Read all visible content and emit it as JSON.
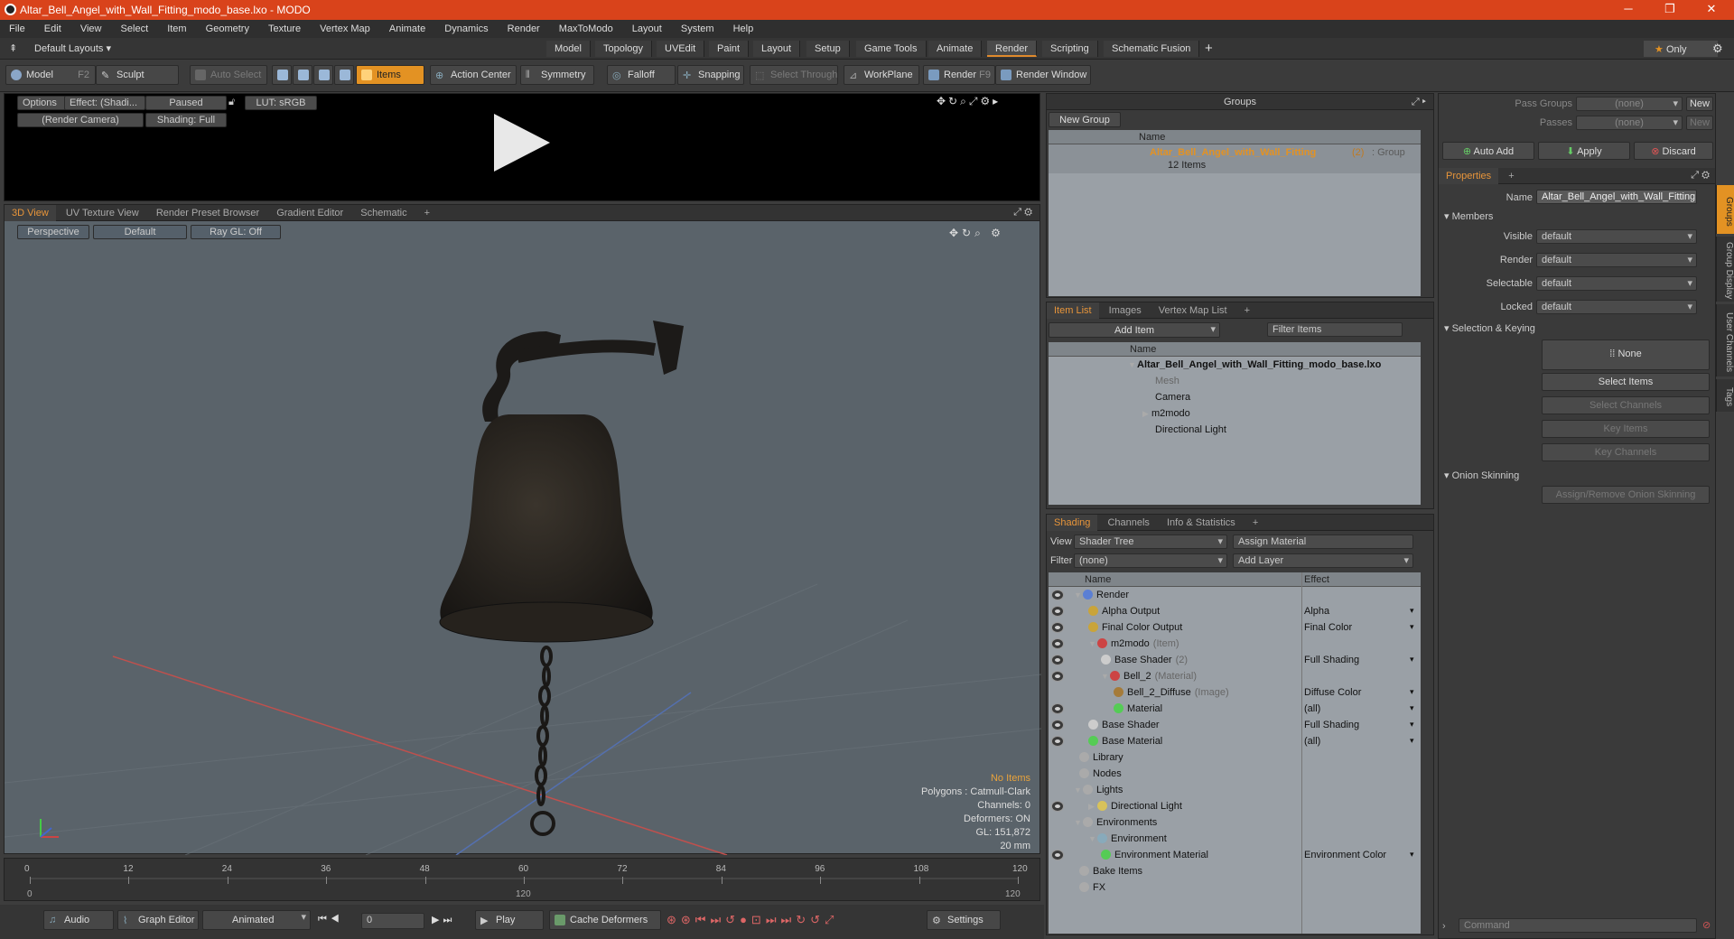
{
  "window": {
    "title": "Altar_Bell_Angel_with_Wall_Fitting_modo_base.lxo - MODO"
  },
  "menu": [
    "File",
    "Edit",
    "View",
    "Select",
    "Item",
    "Geometry",
    "Texture",
    "Vertex Map",
    "Animate",
    "Dynamics",
    "Render",
    "MaxToModo",
    "Layout",
    "System",
    "Help"
  ],
  "layouts": {
    "dropdown": "Default Layouts",
    "tabs": [
      "Model",
      "Topology",
      "UVEdit",
      "Paint",
      "Layout",
      "Setup",
      "Game Tools",
      "Animate",
      "Render",
      "Scripting",
      "Schematic Fusion"
    ],
    "active": "Render",
    "only_label": "Only"
  },
  "toolbar": {
    "model": "Model",
    "model_key": "F2",
    "sculpt": "Sculpt",
    "auto_select": "Auto Select",
    "items": "Items",
    "action_center": "Action Center",
    "symmetry": "Symmetry",
    "falloff": "Falloff",
    "snapping": "Snapping",
    "select_through": "Select Through",
    "workplane": "WorkPlane",
    "render": "Render",
    "render_key": "F9",
    "render_window": "Render Window"
  },
  "render_preview": {
    "options": "Options",
    "effect": "Effect: (Shadi...",
    "paused": "Paused",
    "lut": "LUT: sRGB",
    "camera": "(Render Camera)",
    "shading": "Shading: Full"
  },
  "viewport": {
    "tabs": [
      "3D View",
      "UV Texture View",
      "Render Preset Browser",
      "Gradient Editor",
      "Schematic"
    ],
    "perspective": "Perspective",
    "default": "Default",
    "raygl": "Ray GL: Off",
    "info": {
      "no_items": "No Items",
      "polygons": "Polygons : Catmull-Clark",
      "channels": "Channels: 0",
      "deformers": "Deformers: ON",
      "gl": "GL: 151,872",
      "unit": "20 mm"
    }
  },
  "timeline": {
    "ticks": [
      "0",
      "12",
      "24",
      "36",
      "48",
      "60",
      "72",
      "84",
      "96",
      "108",
      "120"
    ],
    "start": "0",
    "end": "120",
    "end_right": "120"
  },
  "bottombar": {
    "audio": "Audio",
    "graph_editor": "Graph Editor",
    "animated": "Animated",
    "frame": "0",
    "play": "Play",
    "cache_deformers": "Cache Deformers",
    "settings": "Settings"
  },
  "groups": {
    "title": "Groups",
    "new_group": "New Group",
    "col_name": "Name",
    "item_name": "Altar_Bell_Angel_with_Wall_Fitting",
    "item_count": "(2)",
    "item_type": ": Group",
    "item_sub": "12 Items"
  },
  "itemlist": {
    "tabs": [
      "Item List",
      "Images",
      "Vertex Map List"
    ],
    "add_item": "Add Item",
    "filter": "Filter Items",
    "col_name": "Name",
    "rows": [
      "Altar_Bell_Angel_with_Wall_Fitting_modo_base.lxo",
      "Mesh",
      "Camera",
      "m2modo",
      "Directional Light"
    ]
  },
  "shading": {
    "tabs": [
      "Shading",
      "Channels",
      "Info & Statistics"
    ],
    "view_label": "View",
    "view_value": "Shader Tree",
    "assign_material": "Assign Material",
    "filter_label": "Filter",
    "filter_value": "(none)",
    "add_layer": "Add Layer",
    "col_name": "Name",
    "col_effect": "Effect",
    "rows": [
      {
        "name": "Render",
        "effect": "",
        "sub": ""
      },
      {
        "name": "Alpha Output",
        "effect": "Alpha",
        "sub": ""
      },
      {
        "name": "Final Color Output",
        "effect": "Final Color",
        "sub": ""
      },
      {
        "name": "m2modo",
        "effect": "",
        "sub": "(Item)"
      },
      {
        "name": "Base Shader",
        "effect": "Full Shading",
        "sub": "(2)"
      },
      {
        "name": "Bell_2",
        "effect": "",
        "sub": "(Material)"
      },
      {
        "name": "Bell_2_Diffuse",
        "effect": "Diffuse Color",
        "sub": "(Image)"
      },
      {
        "name": "Material",
        "effect": "(all)",
        "sub": ""
      },
      {
        "name": "Base Shader",
        "effect": "Full Shading",
        "sub": ""
      },
      {
        "name": "Base Material",
        "effect": "(all)",
        "sub": ""
      },
      {
        "name": "Library",
        "effect": "",
        "sub": ""
      },
      {
        "name": "Nodes",
        "effect": "",
        "sub": ""
      },
      {
        "name": "Lights",
        "effect": "",
        "sub": ""
      },
      {
        "name": "Directional Light",
        "effect": "",
        "sub": ""
      },
      {
        "name": "Environments",
        "effect": "",
        "sub": ""
      },
      {
        "name": "Environment",
        "effect": "",
        "sub": ""
      },
      {
        "name": "Environment Material",
        "effect": "Environment Color",
        "sub": ""
      },
      {
        "name": "Bake Items",
        "effect": "",
        "sub": ""
      },
      {
        "name": "FX",
        "effect": "",
        "sub": ""
      }
    ]
  },
  "properties": {
    "pass_groups_label": "Pass Groups",
    "pass_groups_value": "(none)",
    "passes_label": "Passes",
    "passes_value": "(none)",
    "new": "New",
    "auto_add": "Auto Add",
    "apply": "Apply",
    "discard": "Discard",
    "tab": "Properties",
    "name_label": "Name",
    "name_value": "Altar_Bell_Angel_with_Wall_Fitting (",
    "members": "Members",
    "visible_label": "Visible",
    "render_label": "Render",
    "selectable_label": "Selectable",
    "locked_label": "Locked",
    "default_value": "default",
    "selection_keying": "Selection & Keying",
    "none": "None",
    "select_items": "Select Items",
    "select_channels": "Select Channels",
    "key_items": "Key Items",
    "key_channels": "Key Channels",
    "onion": "Onion Skinning",
    "assign_onion": "Assign/Remove Onion Skinning",
    "command": "Command",
    "side_tabs": [
      "Groups",
      "Group Display",
      "User Channels",
      "Tags"
    ]
  },
  "colors": {
    "accent": "#e39223",
    "title_bar": "#d9431b",
    "viewport_bg": "#5a636a"
  }
}
